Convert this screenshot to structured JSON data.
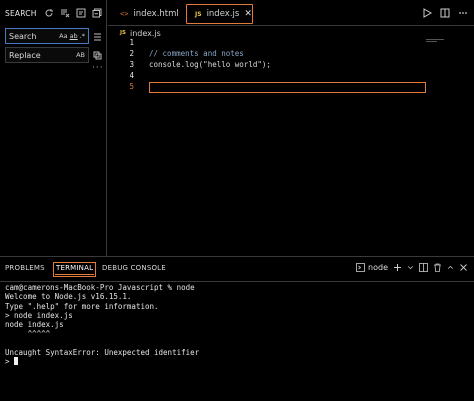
{
  "sidebar": {
    "title": "SEARCH",
    "search": {
      "value": "Search",
      "options": [
        "Aa",
        "ab",
        ".*"
      ]
    },
    "replace": {
      "value": "Replace",
      "options": [
        "AB"
      ]
    },
    "more": "···"
  },
  "tabs": [
    {
      "label": "index.html",
      "icon": "html-file-icon"
    },
    {
      "label": "index.js",
      "icon": "js-file-icon",
      "close": "✕"
    }
  ],
  "breadcrumb": {
    "icon_label": "JS",
    "file": "index.js"
  },
  "editor": {
    "lines": [
      {
        "number": "1",
        "text": ""
      },
      {
        "number": "2",
        "text": "// comments and notes"
      },
      {
        "number": "3",
        "text": "console.log(\"hello world\");"
      },
      {
        "number": "4",
        "text": ""
      },
      {
        "number": "5",
        "text": ""
      }
    ]
  },
  "panel": {
    "tabs": [
      "PROBLEMS",
      "TERMINAL",
      "DEBUG CONSOLE"
    ],
    "terminal_name": "node",
    "terminal_lines": [
      "cam@camerons-MacBook-Pro Javascript % node",
      "Welcome to Node.js v16.15.1.",
      "Type \".help\" for more information.",
      "> node index.js",
      "node index.js",
      "     ^^^^^",
      "",
      "Uncaught SyntaxError: Unexpected identifier",
      "> "
    ]
  },
  "colors": {
    "accent": "#e07b39",
    "focus": "#4a78c2",
    "js": "#e8c547"
  }
}
